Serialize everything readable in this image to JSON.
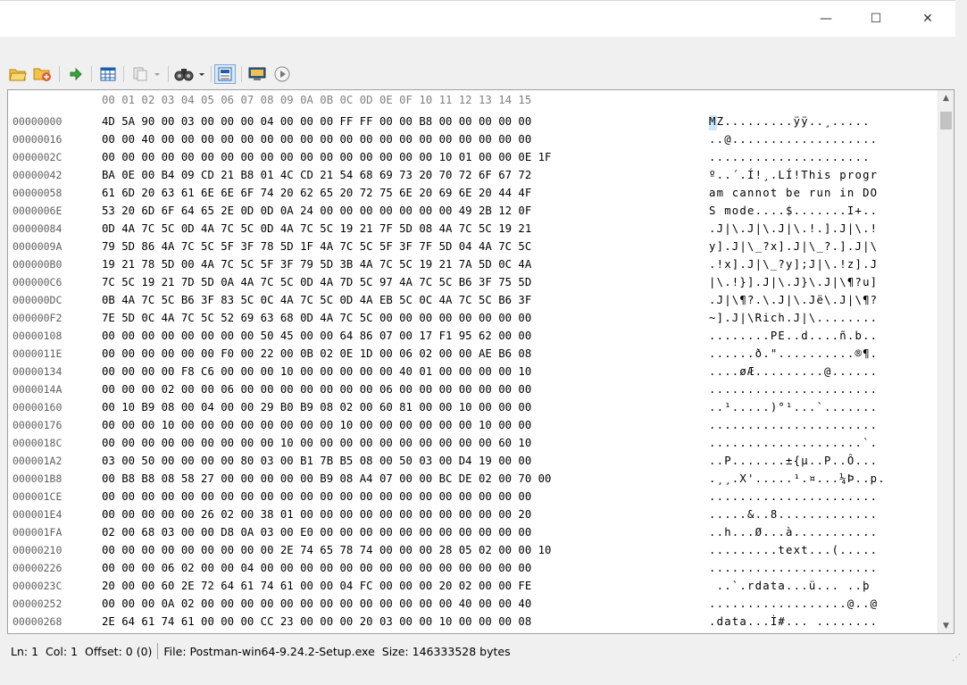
{
  "window": {
    "minimize_glyph": "—",
    "maximize_glyph": "☐",
    "close_glyph": "✕"
  },
  "toolbar": {
    "icons": [
      "open-folder-icon",
      "open-file-icon",
      "go-arrow-icon",
      "table-icon",
      "copy-icon",
      "find-icon",
      "text-mode-icon",
      "display-icon",
      "play-icon"
    ]
  },
  "editor": {
    "column_header": "00 01 02 03 04 05 06 07 08 09 0A 0B 0C 0D 0E 0F 10 11 12 13 14 15",
    "rows": [
      {
        "offset": "00000000",
        "hex": "4D 5A 90 00 03 00 00 00 04 00 00 00 FF FF 00 00 B8 00 00 00 00 00",
        "ascii": "MZ.........ÿÿ..¸....."
      },
      {
        "offset": "00000016",
        "hex": "00 00 40 00 00 00 00 00 00 00 00 00 00 00 00 00 00 00 00 00 00 00",
        "ascii": "..@..................."
      },
      {
        "offset": "0000002C",
        "hex": "00 00 00 00 00 00 00 00 00 00 00 00 00 00 00 00 00 10 01 00 00 0E 1F",
        "ascii": "....................."
      },
      {
        "offset": "00000042",
        "hex": "BA 0E 00 B4 09 CD 21 B8 01 4C CD 21 54 68 69 73 20 70 72 6F 67 72",
        "ascii": "º..´.Í!¸.LÍ!This progr"
      },
      {
        "offset": "00000058",
        "hex": "61 6D 20 63 61 6E 6E 6F 74 20 62 65 20 72 75 6E 20 69 6E 20 44 4F",
        "ascii": "am cannot be run in DO"
      },
      {
        "offset": "0000006E",
        "hex": "53 20 6D 6F 64 65 2E 0D 0D 0A 24 00 00 00 00 00 00 00 49 2B 12 0F",
        "ascii": "S mode....$.......I+.."
      },
      {
        "offset": "00000084",
        "hex": "0D 4A 7C 5C 0D 4A 7C 5C 0D 4A 7C 5C 19 21 7F 5D 08 4A 7C 5C 19 21",
        "ascii": ".J|\\.J|\\.J|\\.!.].J|\\.!"
      },
      {
        "offset": "0000009A",
        "hex": "79 5D 86 4A 7C 5C 5F 3F 78 5D 1F 4A 7C 5C 5F 3F 7F 5D 04 4A 7C 5C",
        "ascii": "y].J|\\_?x].J|\\_?.].J|\\"
      },
      {
        "offset": "000000B0",
        "hex": "19 21 78 5D 00 4A 7C 5C 5F 3F 79 5D 3B 4A 7C 5C 19 21 7A 5D 0C 4A",
        "ascii": ".!x].J|\\_?y];J|\\.!z].J"
      },
      {
        "offset": "000000C6",
        "hex": "7C 5C 19 21 7D 5D 0A 4A 7C 5C 0D 4A 7D 5C 97 4A 7C 5C B6 3F 75 5D",
        "ascii": "|\\.!}].J|\\.J}\\.J|\\¶?u]"
      },
      {
        "offset": "000000DC",
        "hex": "0B 4A 7C 5C B6 3F 83 5C 0C 4A 7C 5C 0D 4A EB 5C 0C 4A 7C 5C B6 3F",
        "ascii": ".J|\\¶?.\\.J|\\.Jë\\.J|\\¶?"
      },
      {
        "offset": "000000F2",
        "hex": "7E 5D 0C 4A 7C 5C 52 69 63 68 0D 4A 7C 5C 00 00 00 00 00 00 00 00",
        "ascii": "~].J|\\Rich.J|\\........"
      },
      {
        "offset": "00000108",
        "hex": "00 00 00 00 00 00 00 00 50 45 00 00 64 86 07 00 17 F1 95 62 00 00",
        "ascii": "........PE..d....ñ.b.."
      },
      {
        "offset": "0000011E",
        "hex": "00 00 00 00 00 00 F0 00 22 00 0B 02 0E 1D 00 06 02 00 00 AE B6 08",
        "ascii": "......ð.\"..........®¶."
      },
      {
        "offset": "00000134",
        "hex": "00 00 00 00 F8 C6 00 00 00 10 00 00 00 00 00 40 01 00 00 00 00 10",
        "ascii": "....øÆ.........@......"
      },
      {
        "offset": "0000014A",
        "hex": "00 00 00 02 00 00 06 00 00 00 00 00 00 00 06 00 00 00 00 00 00 00",
        "ascii": "......................"
      },
      {
        "offset": "00000160",
        "hex": "00 10 B9 08 00 04 00 00 29 B0 B9 08 02 00 60 81 00 00 10 00 00 00",
        "ascii": "..¹.....)°¹...`......."
      },
      {
        "offset": "00000176",
        "hex": "00 00 00 10 00 00 00 00 00 00 00 00 10 00 00 00 00 00 00 10 00 00",
        "ascii": "......................"
      },
      {
        "offset": "0000018C",
        "hex": "00 00 00 00 00 00 00 00 00 10 00 00 00 00 00 00 00 00 00 00 60 10",
        "ascii": "....................`."
      },
      {
        "offset": "000001A2",
        "hex": "03 00 50 00 00 00 00 80 03 00 B1 7B B5 08 00 50 03 00 D4 19 00 00",
        "ascii": "..P.......±{µ..P..Ô..."
      },
      {
        "offset": "000001B8",
        "hex": "00 B8 B8 08 58 27 00 00 00 00 00 B9 08 A4 07 00 00 BC DE 02 00 70 00",
        "ascii": ".¸¸.X'.....¹.¤...¼Þ..p."
      },
      {
        "offset": "000001CE",
        "hex": "00 00 00 00 00 00 00 00 00 00 00 00 00 00 00 00 00 00 00 00 00 00",
        "ascii": "......................"
      },
      {
        "offset": "000001E4",
        "hex": "00 00 00 00 00 26 02 00 38 01 00 00 00 00 00 00 00 00 00 00 00 20",
        "ascii": ".....&..8............."
      },
      {
        "offset": "000001FA",
        "hex": "02 00 68 03 00 00 D8 0A 03 00 E0 00 00 00 00 00 00 00 00 00 00 00",
        "ascii": "..h...Ø...à..........."
      },
      {
        "offset": "00000210",
        "hex": "00 00 00 00 00 00 00 00 00 2E 74 65 78 74 00 00 00 28 05 02 00 00 10",
        "ascii": ".........text...(....."
      },
      {
        "offset": "00000226",
        "hex": "00 00 00 06 02 00 00 04 00 00 00 00 00 00 00 00 00 00 00 00 00 00",
        "ascii": "......................"
      },
      {
        "offset": "0000023C",
        "hex": "20 00 00 60 2E 72 64 61 74 61 00 00 04 FC 00 00 00 20 02 00 00 FE",
        "ascii": " ..`.rdata...ü... ..þ"
      },
      {
        "offset": "00000252",
        "hex": "00 00 00 0A 02 00 00 00 00 00 00 00 00 00 00 00 00 00 40 00 00 40",
        "ascii": "..................@..@"
      },
      {
        "offset": "00000268",
        "hex": "2E 64 61 74 61 00 00 00 CC 23 00 00 00 20 03 00 00 10 00 00 00 08",
        "ascii": ".data...Ì#... ........"
      }
    ]
  },
  "status": {
    "line": "Ln: 1",
    "col": "Col: 1",
    "offset": "Offset: 0 (0)",
    "file": "File: Postman-win64-9.24.2-Setup.exe",
    "size": "Size: 146333528 bytes"
  }
}
